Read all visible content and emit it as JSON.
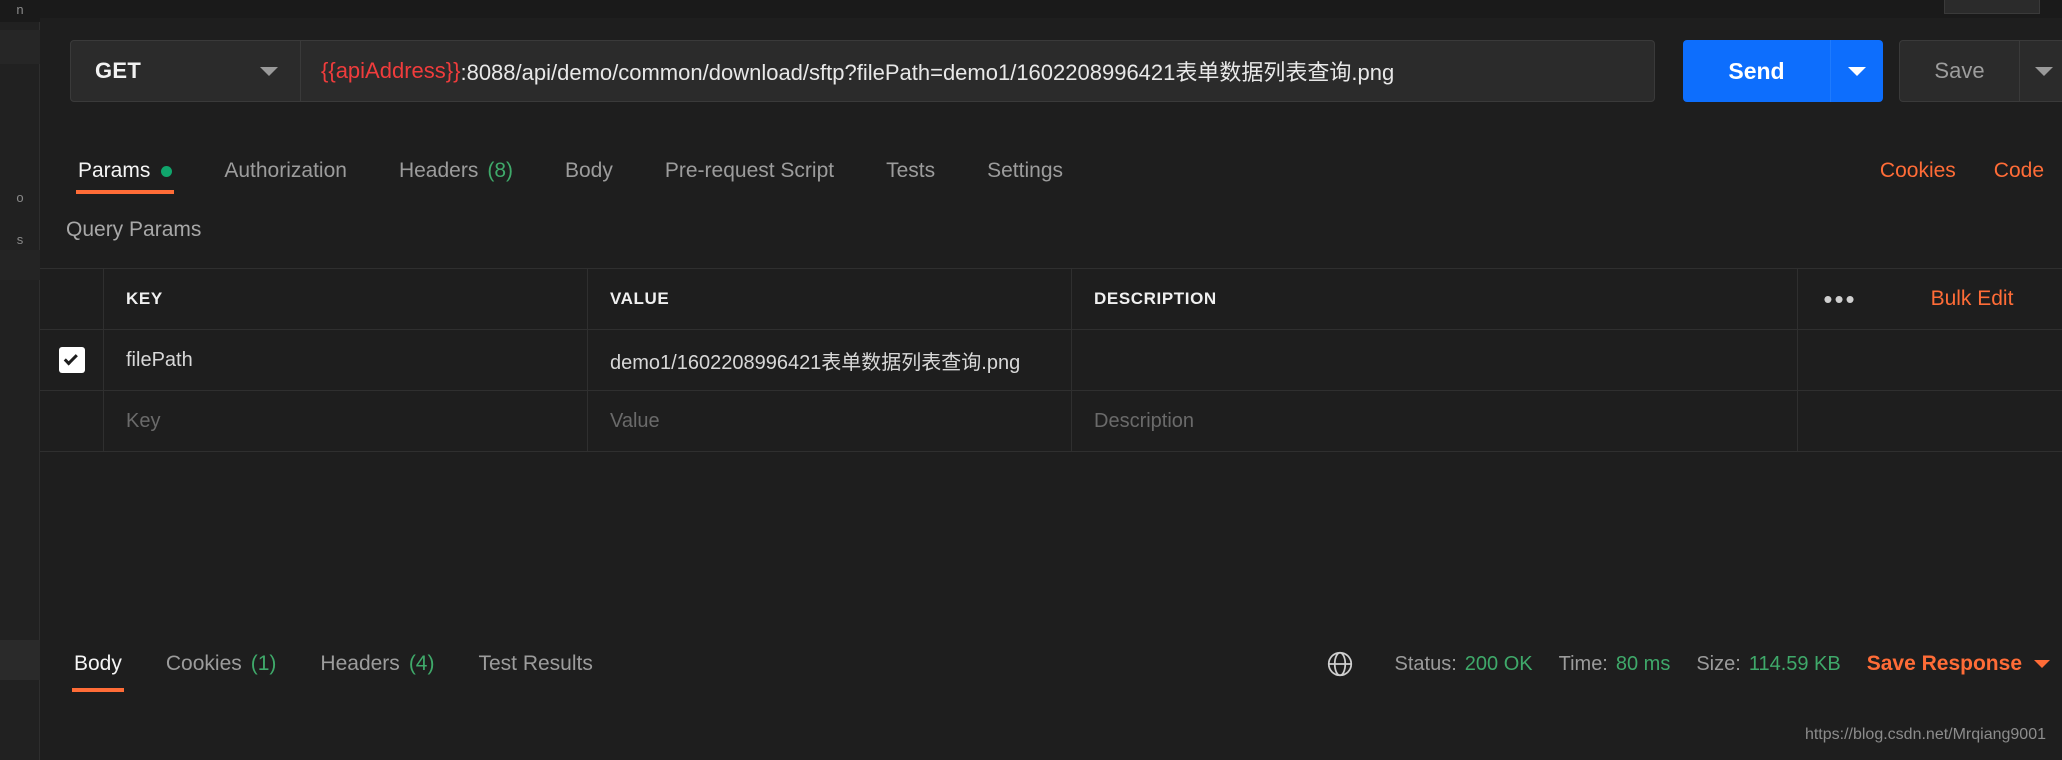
{
  "request": {
    "method": "GET",
    "url_variable": "{{apiAddress}}",
    "url_rest": ":8088/api/demo/common/download/sftp?filePath=demo1/1602208996421表单数据列表查询.png",
    "send_label": "Send",
    "save_label": "Save"
  },
  "tabs": [
    {
      "label": "Params",
      "active": true,
      "indicator": "dot"
    },
    {
      "label": "Authorization",
      "active": false
    },
    {
      "label": "Headers",
      "active": false,
      "count": "(8)"
    },
    {
      "label": "Body",
      "active": false
    },
    {
      "label": "Pre-request Script",
      "active": false
    },
    {
      "label": "Tests",
      "active": false
    },
    {
      "label": "Settings",
      "active": false
    }
  ],
  "tabs_right": {
    "cookies": "Cookies",
    "code": "Code"
  },
  "query_params": {
    "section_title": "Query Params",
    "headers": {
      "key": "KEY",
      "value": "VALUE",
      "description": "DESCRIPTION",
      "more": "•••",
      "bulk_edit": "Bulk Edit"
    },
    "rows": [
      {
        "checked": true,
        "key": "filePath",
        "value": "demo1/1602208996421表单数据列表查询.png",
        "description": ""
      }
    ],
    "empty_row": {
      "key_placeholder": "Key",
      "value_placeholder": "Value",
      "description_placeholder": "Description"
    }
  },
  "response": {
    "tabs": [
      {
        "label": "Body",
        "active": true
      },
      {
        "label": "Cookies",
        "active": false,
        "count": "(1)"
      },
      {
        "label": "Headers",
        "active": false,
        "count": "(4)"
      },
      {
        "label": "Test Results",
        "active": false
      }
    ],
    "status_label": "Status:",
    "status_value": "200 OK",
    "time_label": "Time:",
    "time_value": "80 ms",
    "size_label": "Size:",
    "size_value": "114.59 KB",
    "save_response": "Save Response"
  },
  "watermark": "https://blog.csdn.net/Mrqiang9001",
  "colors": {
    "accent_orange": "#ff6c37",
    "send_blue": "#0d6efd",
    "status_green": "#3fa96a",
    "variable_red": "#f03c3c"
  }
}
